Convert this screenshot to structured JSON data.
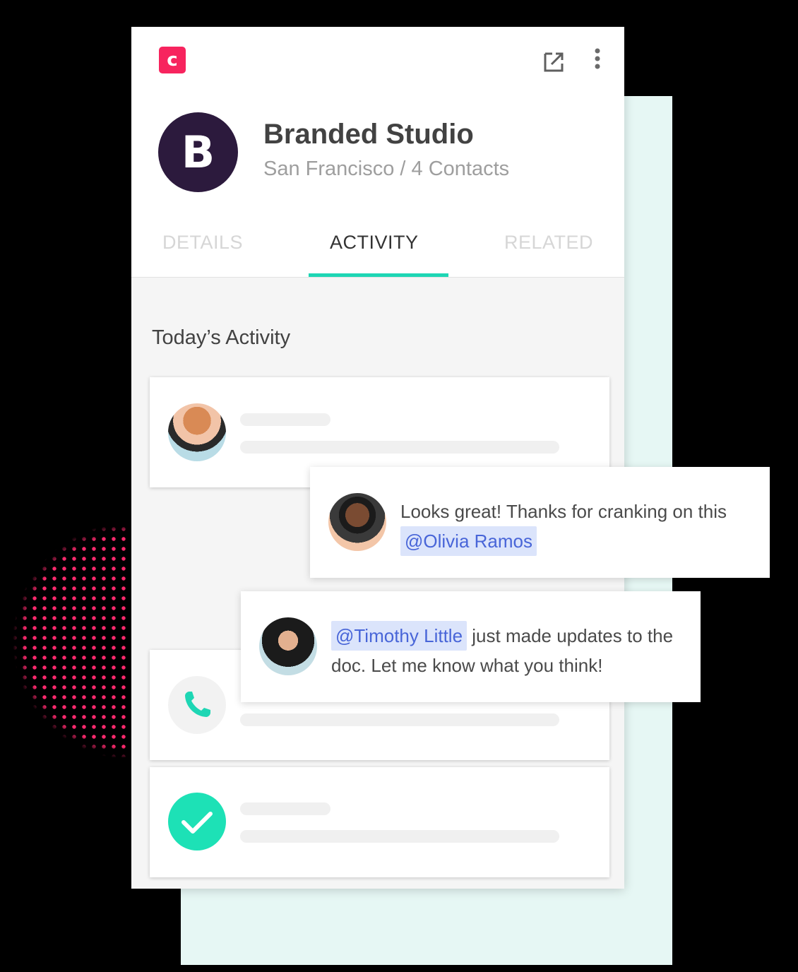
{
  "header": {
    "logo_letter": "c",
    "open_icon": "open-external-icon",
    "more_icon": "more-vertical-icon"
  },
  "company": {
    "avatar_letter": "B",
    "name": "Branded Studio",
    "meta": "San Francisco / 4 Contacts"
  },
  "tabs": [
    {
      "label": "DETAILS",
      "active": false
    },
    {
      "label": "ACTIVITY",
      "active": true
    },
    {
      "label": "RELATED",
      "active": false
    }
  ],
  "activity": {
    "section_title": "Today’s Activity",
    "cards": [
      {
        "icon": "avatar-photo"
      },
      {
        "icon": "phone-icon"
      },
      {
        "icon": "check-icon"
      }
    ]
  },
  "comments": [
    {
      "text": "Looks great! Thanks for cranking on this",
      "mention": "@Olivia Ramos"
    },
    {
      "mention": "@Timothy Little",
      "text": "just made updates to the doc. Let me know what you think!"
    }
  ],
  "colors": {
    "brand": "#f7245e",
    "accent": "#1ed6b4",
    "avatar_bg": "#2c1a3d",
    "mention_bg": "#dbe4fb",
    "mention_text": "#4865d8"
  }
}
